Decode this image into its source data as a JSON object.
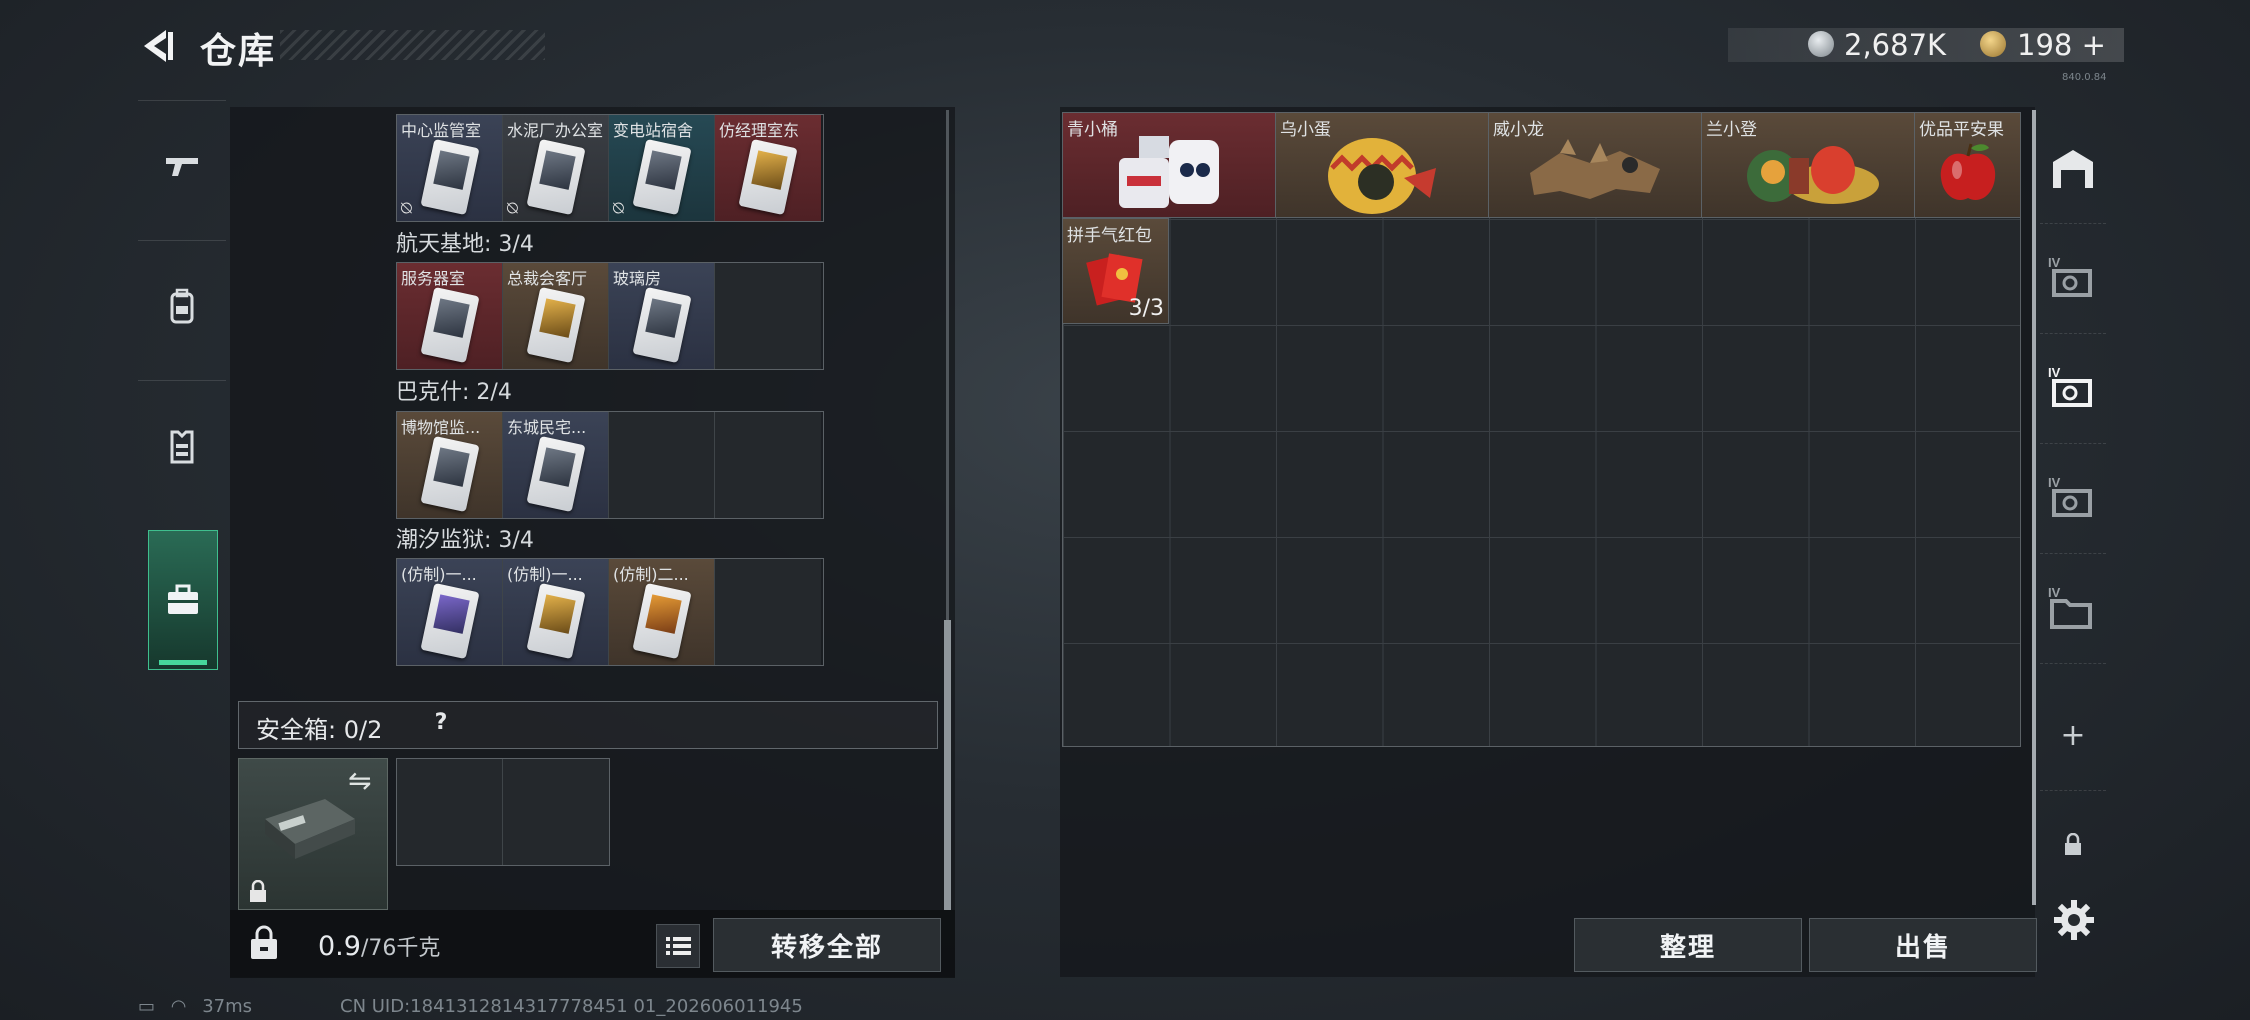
{
  "header": {
    "title": "仓库",
    "currency_silver": "2,687K",
    "currency_gold": "198",
    "add_symbol": "+",
    "version": "840.0.84"
  },
  "left_nav": {
    "items": [
      "gun-icon",
      "backpack-icon",
      "vest-icon",
      "case-icon"
    ],
    "active_index": 3
  },
  "keycards": {
    "row0": {
      "cards": [
        {
          "name": "中心监管室",
          "color": "blue",
          "card": "",
          "unavailable": true
        },
        {
          "name": "水泥厂办公室",
          "color": "gray",
          "card": "",
          "unavailable": true
        },
        {
          "name": "变电站宿舍",
          "color": "teal",
          "card": "",
          "unavailable": true
        },
        {
          "name": "仿经理室东",
          "color": "red",
          "card": "gold",
          "unavailable": false
        }
      ]
    },
    "group1": {
      "label": "航天基地: 3/4",
      "cards": [
        {
          "name": "服务器室",
          "color": "red",
          "card": ""
        },
        {
          "name": "总裁会客厅",
          "color": "brown",
          "card": "gold"
        },
        {
          "name": "玻璃房",
          "color": "blue",
          "card": ""
        },
        {
          "name": "",
          "color": "empty",
          "card": ""
        }
      ]
    },
    "group2": {
      "label": "巴克什: 2/4",
      "cards": [
        {
          "name": "博物馆监...",
          "color": "brown",
          "card": ""
        },
        {
          "name": "东城民宅...",
          "color": "blue",
          "card": ""
        },
        {
          "name": "",
          "color": "empty",
          "card": ""
        },
        {
          "name": "",
          "color": "empty",
          "card": ""
        }
      ]
    },
    "group3": {
      "label": "潮汐监狱: 3/4",
      "cards": [
        {
          "name": "(仿制)一...",
          "color": "blue",
          "card": "violet"
        },
        {
          "name": "(仿制)一...",
          "color": "blue",
          "card": "gold"
        },
        {
          "name": "(仿制)二...",
          "color": "brown",
          "card": "amber"
        },
        {
          "name": "",
          "color": "empty",
          "card": ""
        }
      ]
    }
  },
  "safe": {
    "label": "安全箱: 0/2",
    "help": "?"
  },
  "footer_left": {
    "weight_current": "0.9",
    "weight_max": "/76千克",
    "transfer_all": "转移全部"
  },
  "stash_items": [
    {
      "name": "青小桶",
      "color": "red",
      "icon": "bucket-figure-icon"
    },
    {
      "name": "乌小蛋",
      "color": "brown",
      "icon": "egg-figure-icon"
    },
    {
      "name": "威小龙",
      "color": "brown",
      "icon": "dragon-figure-icon"
    },
    {
      "name": "兰小登",
      "color": "brown",
      "icon": "sombrero-figure-icon"
    },
    {
      "name": "优品平安果",
      "color": "brown",
      "icon": "apple-icon"
    },
    {
      "name": "拼手气红包",
      "color": "brown",
      "icon": "red-envelope-icon",
      "count": "3/3"
    }
  ],
  "right_footer": {
    "sort": "整理",
    "sell": "出售"
  },
  "right_nav": {
    "badge": "IV",
    "plus": "+"
  },
  "status": {
    "ping": "37ms",
    "uid": "CN UID:1841312814317778451 01_202606011945"
  }
}
